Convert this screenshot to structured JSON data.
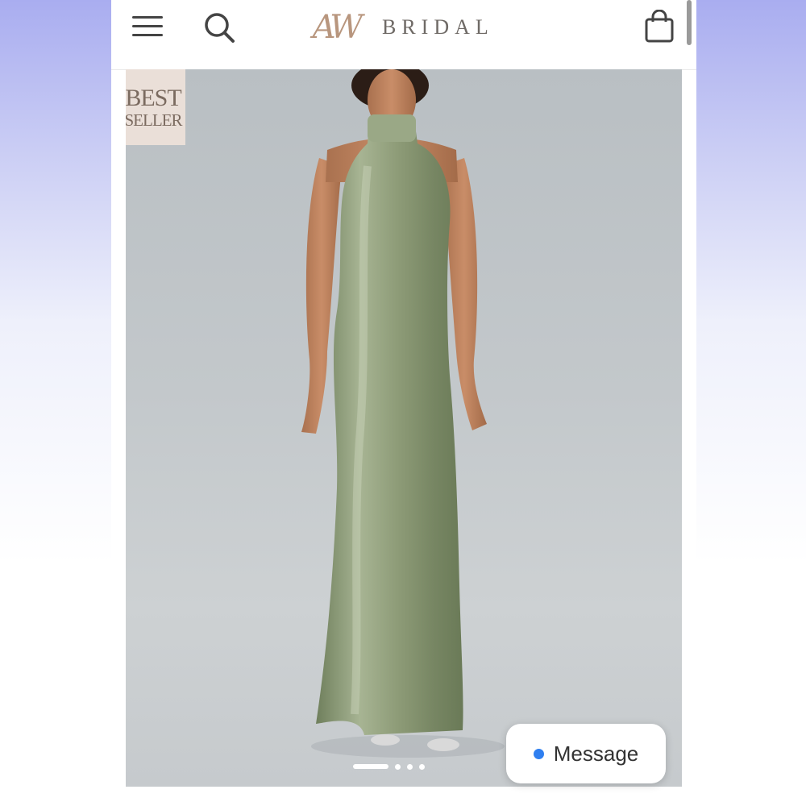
{
  "header": {
    "logo_mark": "AW",
    "logo_text": "BRIDAL",
    "icons": [
      "menu-icon",
      "search-icon",
      "shopping-bag-icon"
    ]
  },
  "product": {
    "badge_line1": "BEST",
    "badge_line2": "SELLER",
    "dress_color": "#8a9a74",
    "image_count": 4,
    "active_image": 1
  },
  "chat": {
    "label": "Message",
    "status_color": "#2f7ff0"
  }
}
